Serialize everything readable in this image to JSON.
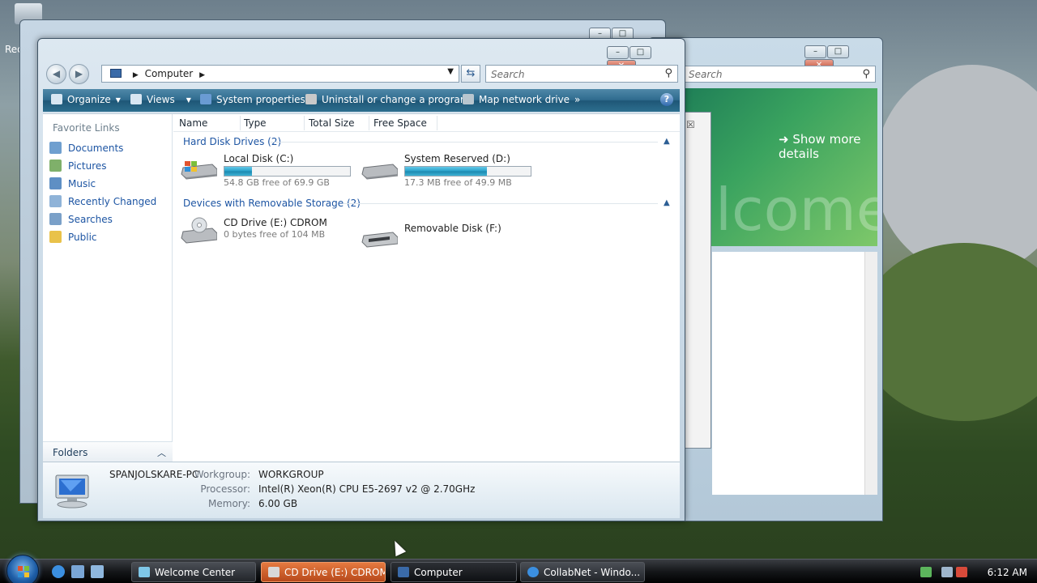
{
  "desktop": {
    "recycle_label": "Rec"
  },
  "background_window": {
    "search_placeholder": "Search",
    "banner_link": "Show more details",
    "banner_watermark": "lcome"
  },
  "window": {
    "address": {
      "location": "Computer"
    },
    "search_placeholder": "Search",
    "toolbar": {
      "organize": "Organize",
      "views": "Views",
      "system_properties": "System properties",
      "uninstall": "Uninstall or change a program",
      "map_drive": "Map network drive",
      "more": "»"
    },
    "sidebar": {
      "heading": "Favorite Links",
      "items": [
        {
          "label": "Documents",
          "icon": "documents-icon"
        },
        {
          "label": "Pictures",
          "icon": "pictures-icon"
        },
        {
          "label": "Music",
          "icon": "music-icon"
        },
        {
          "label": "Recently Changed",
          "icon": "recent-icon"
        },
        {
          "label": "Searches",
          "icon": "searches-icon"
        },
        {
          "label": "Public",
          "icon": "public-folder-icon"
        }
      ],
      "folders_label": "Folders"
    },
    "columns": [
      "Name",
      "Type",
      "Total Size",
      "Free Space"
    ],
    "groups": {
      "hard_disks": {
        "title": "Hard Disk Drives (2)",
        "drives": [
          {
            "name": "Local Disk (C:)",
            "free_text": "54.8 GB free of 69.9 GB",
            "used_fraction": 0.22
          },
          {
            "name": "System Reserved (D:)",
            "free_text": "17.3 MB free of 49.9 MB",
            "used_fraction": 0.65
          }
        ]
      },
      "removable": {
        "title": "Devices with Removable Storage (2)",
        "drives": [
          {
            "name": "CD Drive (E:) CDROM",
            "free_text": "0 bytes free of 104 MB"
          },
          {
            "name": "Removable Disk (F:)",
            "free_text": ""
          }
        ]
      }
    },
    "details": {
      "computer_name": "SPANJOLSKARE-PC",
      "workgroup_label": "Workgroup:",
      "workgroup": "WORKGROUP",
      "processor_label": "Processor:",
      "processor": "Intel(R) Xeon(R) CPU E5-2697 v2 @ 2.70GHz",
      "memory_label": "Memory:",
      "memory": "6.00 GB"
    }
  },
  "taskbar": {
    "buttons": [
      {
        "label": "Welcome Center"
      },
      {
        "label": "CD Drive (E:) CDROM"
      },
      {
        "label": "Computer"
      },
      {
        "label": "CollabNet - Windo..."
      }
    ],
    "clock": "6:12 AM"
  },
  "colors": {
    "toolbar": "#2f6b8e",
    "link": "#1d55a3",
    "progress": "#27a0c8",
    "taskbar_active": "#b7491b"
  }
}
